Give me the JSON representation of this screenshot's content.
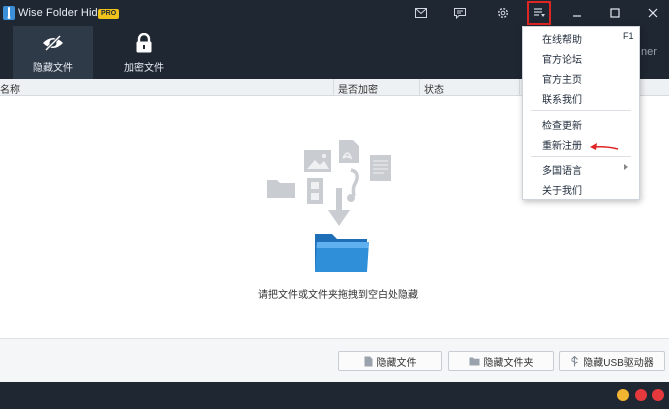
{
  "app": {
    "title": "Wise Folder Hider",
    "badge": "PRO"
  },
  "titlebar": {
    "icons": [
      "mail-icon",
      "feedback-icon",
      "settings-icon",
      "menu-list-icon",
      "minimize-icon",
      "maximize-icon",
      "close-icon"
    ]
  },
  "toolbar": {
    "tabs": [
      {
        "label": "隐藏文件",
        "icon": "eye-slash-icon",
        "active": true
      },
      {
        "label": "加密文件",
        "icon": "lock-icon",
        "active": false
      }
    ]
  },
  "table": {
    "columns": [
      "名称",
      "是否加密",
      "状态"
    ]
  },
  "drop_zone": {
    "hint": "请把文件或文件夹拖拽到空白处隐藏"
  },
  "actions": {
    "hide_file": "隐藏文件",
    "hide_folder": "隐藏文件夹",
    "hide_usb": "隐藏USB驱动器"
  },
  "menu": {
    "items": [
      {
        "label": "在线帮助",
        "shortcut": "F1"
      },
      {
        "label": "官方论坛"
      },
      {
        "label": "官方主页"
      },
      {
        "label": "联系我们"
      },
      {
        "label": "检查更新"
      },
      {
        "label": "重新注册"
      },
      {
        "label": "多国语言",
        "submenu": true
      },
      {
        "label": "关于我们"
      }
    ],
    "overflow_text": "ner"
  },
  "colors": {
    "dark_bg": "#1f2733",
    "active_tab": "#2f3a49",
    "highlight": "#e02525",
    "folder_blue": "#2f8fd8"
  }
}
